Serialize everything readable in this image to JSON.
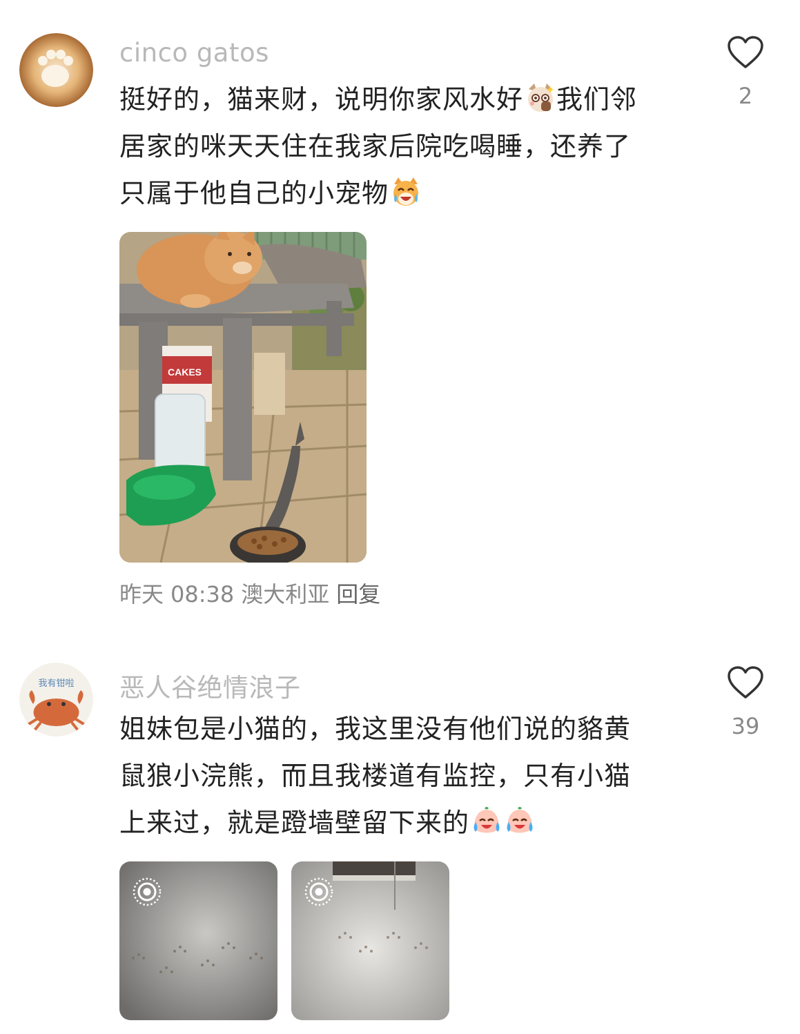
{
  "comments": [
    {
      "username": "cinco gatos",
      "lines": [
        "挺好的，猫来财，说明你家风水好",
        "我们邻",
        "居家的咪天天住在我家后院吃喝睡，还养了",
        "只属于他自己的小宠物"
      ],
      "emojis": [
        "cat-shy-emoji",
        "cat-laughing-crying-emoji"
      ],
      "likes": "2",
      "photo_count": 1,
      "photo_texts": [
        "CAKES"
      ],
      "meta": {
        "date": "昨天",
        "time": "08:38",
        "location": "澳大利亚",
        "reply_label": "回复"
      }
    },
    {
      "username": "恶人谷绝情浪子",
      "avatar_text": "我有钳啦",
      "lines": [
        "姐妹包是小猫的，我这里没有他们说的貉黄",
        "鼠狼小浣熊，而且我楼道有监控，只有小猫",
        "上来过，就是蹬墙壁留下来的"
      ],
      "emojis": [
        "crying-laughing-face-emoji",
        "crying-laughing-face-emoji"
      ],
      "likes": "39",
      "photo_count": 2,
      "photo_badges": [
        "live-photo-icon",
        "live-photo-icon"
      ]
    }
  ],
  "colors": {
    "username": "#b8b8b8",
    "text": "#222222",
    "meta": "#888888",
    "background": "#ffffff"
  }
}
